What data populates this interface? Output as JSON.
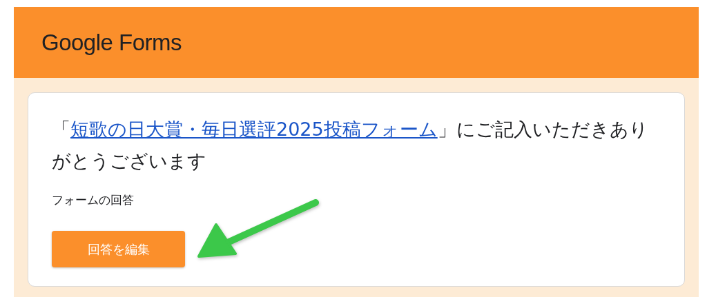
{
  "header": {
    "logo": "Google Forms"
  },
  "card": {
    "title_prefix": "「",
    "form_link": "短歌の日大賞・毎日選評2025投稿フォーム",
    "title_suffix": "」にご記入いただきありがとうございます",
    "response_label": "フォームの回答",
    "edit_button": "回答を編集"
  },
  "annotation": {
    "kind": "arrow",
    "color": "#3cc84a"
  }
}
